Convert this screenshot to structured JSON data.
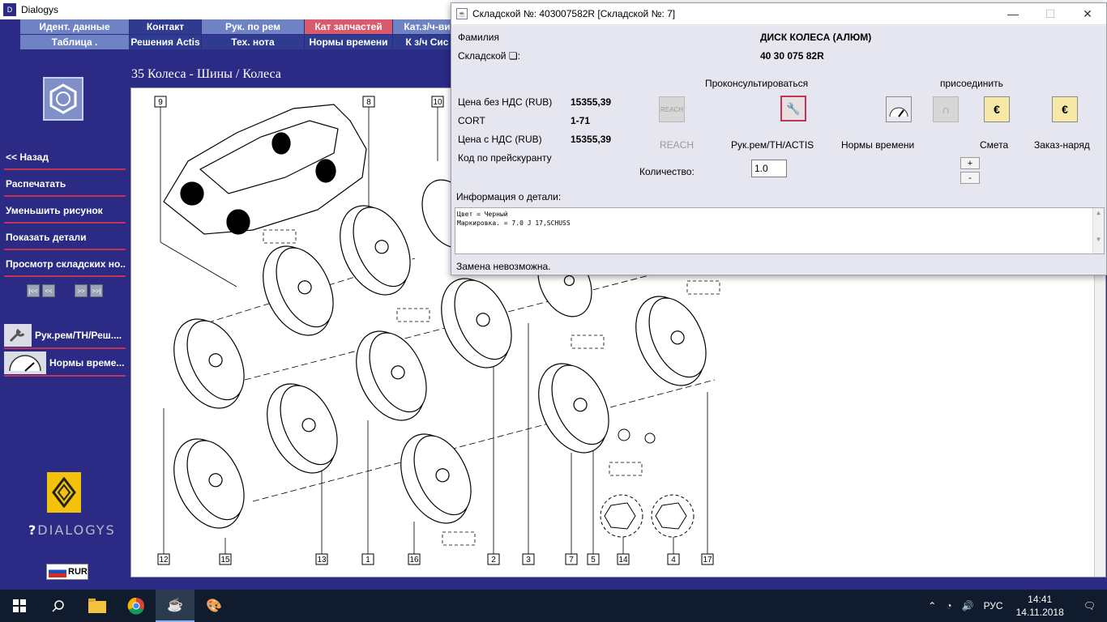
{
  "app": {
    "title": "Dialogys",
    "icon_name": "dialogys-app-icon"
  },
  "menu": {
    "row1": [
      "Идент. данные",
      "Контакт",
      "Рук. по рем",
      "Кат запчастей",
      "Кат.з/ч-ви"
    ],
    "row2": [
      "Таблица .",
      "Решения Actis",
      "Тех. нота",
      "Нормы времени",
      "К з/ч Сис"
    ],
    "active_row1_index": 3,
    "colors": {
      "menu_bg": "#6f83c4",
      "menu_dark": "#2e3b8f",
      "menu_active": "#d85a6c"
    }
  },
  "sidebar": {
    "links": [
      "<< Назад",
      "Распечатать",
      "Уменьшить рисунок",
      "Показать детали",
      "Просмотр складских но..."
    ],
    "pager": [
      "|<<",
      "<<",
      ">>",
      ">>|"
    ],
    "shortcuts": [
      {
        "label": "Рук.рем/ТН/Реш....",
        "icon": "wrench-icon"
      },
      {
        "label": "Нормы време...",
        "icon": "gauge-icon"
      }
    ],
    "brand": "DIALOGYS",
    "currency": "RUR"
  },
  "diagram": {
    "heading": "35 Колеса - Шины / Колеса",
    "top_callouts": [
      "9",
      "8",
      "10"
    ],
    "bottom_callouts": [
      "12",
      "15",
      "13",
      "1",
      "16",
      "2",
      "3",
      "7",
      "5",
      "14",
      "4",
      "17"
    ]
  },
  "part_dialog": {
    "title": "Складской №: 403007582R [Складской №: 7]",
    "labels": {
      "surname": "Фамилия",
      "part_no": "Складской ❏:",
      "price_net": "Цена без НДС (RUB)",
      "cort": "CORT",
      "price_gross": "Цена с НДС (RUB)",
      "price_code": "Код по прейскуранту",
      "consult": "Проконсультироваться",
      "attach": "присоединить",
      "quantity": "Количество:",
      "info": "Информация о детали:"
    },
    "values": {
      "surname": "ДИСК КОЛЕСА (АЛЮМ)",
      "part_no": "40 30 075 82R",
      "price_net": "15355,39",
      "cort": "1-71",
      "price_gross": "15355,39",
      "quantity": "1.0"
    },
    "tools": [
      {
        "label": "REACH",
        "icon": "reach-icon",
        "enabled": false
      },
      {
        "label": "Рук.рем/ТН/ACTIS",
        "icon": "wrench-icon",
        "enabled": true
      },
      {
        "label": "Нормы времени",
        "icon": "gauge-icon",
        "enabled": true
      },
      {
        "label": "",
        "icon": "magnet-icon",
        "enabled": false
      },
      {
        "label": "Смета",
        "icon": "estimate-icon",
        "enabled": true
      },
      {
        "label": "Заказ-наряд",
        "icon": "work-order-icon",
        "enabled": true
      }
    ],
    "info_lines": [
      "Цвет = Черный",
      "Маркировка. = 7.0 J 17,SCHUSS"
    ],
    "status": "Замена невозможна."
  },
  "taskbar": {
    "language": "РУС",
    "time": "14:41",
    "date": "14.11.2018"
  }
}
